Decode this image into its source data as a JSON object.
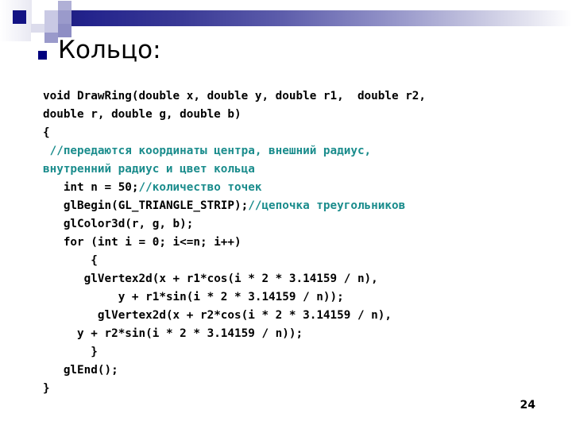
{
  "slide": {
    "title": "Кольцо:",
    "title_bullet_color": "#00007e",
    "number": "24",
    "header_gradient_from": "#1b1b79",
    "header_gradient_to": "#ffffff",
    "comment_color": "#1a8c8c",
    "code_color": "#000000"
  },
  "code": {
    "lines": [
      {
        "id": "line-1",
        "indent": "",
        "code": "void DrawRing(double x, double y, double r1,  double r2,",
        "comment": ""
      },
      {
        "id": "line-2",
        "indent": "",
        "code": "double r, double g, double b)",
        "comment": ""
      },
      {
        "id": "line-3",
        "indent": "",
        "code": "{",
        "comment": ""
      },
      {
        "id": "line-4",
        "indent": " ",
        "code": "",
        "comment": "//передаются координаты центра, внешний радиус,"
      },
      {
        "id": "line-5",
        "indent": "",
        "code": "",
        "comment": "внутренний радиус и цвет кольца"
      },
      {
        "id": "line-6",
        "indent": "   ",
        "code": "int n = 50;",
        "comment": "//количество точек"
      },
      {
        "id": "line-7",
        "indent": "   ",
        "code": "glBegin(GL_TRIANGLE_STRIP);",
        "comment": "//цепочка треугольников"
      },
      {
        "id": "line-8",
        "indent": "   ",
        "code": "glColor3d(r, g, b);",
        "comment": ""
      },
      {
        "id": "line-9",
        "indent": "   ",
        "code": "for (int i = 0; i<=n; i++)",
        "comment": ""
      },
      {
        "id": "line-10",
        "indent": "       ",
        "code": "{",
        "comment": ""
      },
      {
        "id": "line-11",
        "indent": "      ",
        "code": "glVertex2d(x + r1*cos(i * 2 * 3.14159 / n),",
        "comment": ""
      },
      {
        "id": "line-12",
        "indent": "           ",
        "code": "y + r1*sin(i * 2 * 3.14159 / n));",
        "comment": ""
      },
      {
        "id": "line-13",
        "indent": "        ",
        "code": "glVertex2d(x + r2*cos(i * 2 * 3.14159 / n),",
        "comment": ""
      },
      {
        "id": "line-14",
        "indent": "     ",
        "code": "y + r2*sin(i * 2 * 3.14159 / n));",
        "comment": ""
      },
      {
        "id": "line-15",
        "indent": "       ",
        "code": "}",
        "comment": ""
      },
      {
        "id": "line-16",
        "indent": "   ",
        "code": "glEnd();",
        "comment": ""
      },
      {
        "id": "line-17",
        "indent": "",
        "code": "}",
        "comment": ""
      }
    ]
  }
}
